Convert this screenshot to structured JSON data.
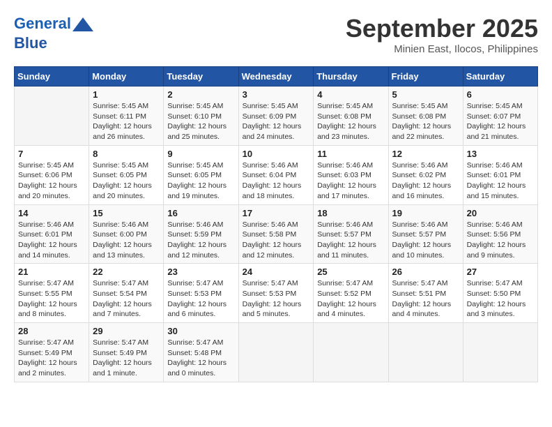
{
  "header": {
    "logo_line1": "General",
    "logo_line2": "Blue",
    "month": "September 2025",
    "location": "Minien East, Ilocos, Philippines"
  },
  "days_of_week": [
    "Sunday",
    "Monday",
    "Tuesday",
    "Wednesday",
    "Thursday",
    "Friday",
    "Saturday"
  ],
  "weeks": [
    [
      {
        "day": "",
        "content": ""
      },
      {
        "day": "1",
        "content": "Sunrise: 5:45 AM\nSunset: 6:11 PM\nDaylight: 12 hours\nand 26 minutes."
      },
      {
        "day": "2",
        "content": "Sunrise: 5:45 AM\nSunset: 6:10 PM\nDaylight: 12 hours\nand 25 minutes."
      },
      {
        "day": "3",
        "content": "Sunrise: 5:45 AM\nSunset: 6:09 PM\nDaylight: 12 hours\nand 24 minutes."
      },
      {
        "day": "4",
        "content": "Sunrise: 5:45 AM\nSunset: 6:08 PM\nDaylight: 12 hours\nand 23 minutes."
      },
      {
        "day": "5",
        "content": "Sunrise: 5:45 AM\nSunset: 6:08 PM\nDaylight: 12 hours\nand 22 minutes."
      },
      {
        "day": "6",
        "content": "Sunrise: 5:45 AM\nSunset: 6:07 PM\nDaylight: 12 hours\nand 21 minutes."
      }
    ],
    [
      {
        "day": "7",
        "content": "Sunrise: 5:45 AM\nSunset: 6:06 PM\nDaylight: 12 hours\nand 20 minutes."
      },
      {
        "day": "8",
        "content": "Sunrise: 5:45 AM\nSunset: 6:05 PM\nDaylight: 12 hours\nand 20 minutes."
      },
      {
        "day": "9",
        "content": "Sunrise: 5:45 AM\nSunset: 6:05 PM\nDaylight: 12 hours\nand 19 minutes."
      },
      {
        "day": "10",
        "content": "Sunrise: 5:46 AM\nSunset: 6:04 PM\nDaylight: 12 hours\nand 18 minutes."
      },
      {
        "day": "11",
        "content": "Sunrise: 5:46 AM\nSunset: 6:03 PM\nDaylight: 12 hours\nand 17 minutes."
      },
      {
        "day": "12",
        "content": "Sunrise: 5:46 AM\nSunset: 6:02 PM\nDaylight: 12 hours\nand 16 minutes."
      },
      {
        "day": "13",
        "content": "Sunrise: 5:46 AM\nSunset: 6:01 PM\nDaylight: 12 hours\nand 15 minutes."
      }
    ],
    [
      {
        "day": "14",
        "content": "Sunrise: 5:46 AM\nSunset: 6:01 PM\nDaylight: 12 hours\nand 14 minutes."
      },
      {
        "day": "15",
        "content": "Sunrise: 5:46 AM\nSunset: 6:00 PM\nDaylight: 12 hours\nand 13 minutes."
      },
      {
        "day": "16",
        "content": "Sunrise: 5:46 AM\nSunset: 5:59 PM\nDaylight: 12 hours\nand 12 minutes."
      },
      {
        "day": "17",
        "content": "Sunrise: 5:46 AM\nSunset: 5:58 PM\nDaylight: 12 hours\nand 12 minutes."
      },
      {
        "day": "18",
        "content": "Sunrise: 5:46 AM\nSunset: 5:57 PM\nDaylight: 12 hours\nand 11 minutes."
      },
      {
        "day": "19",
        "content": "Sunrise: 5:46 AM\nSunset: 5:57 PM\nDaylight: 12 hours\nand 10 minutes."
      },
      {
        "day": "20",
        "content": "Sunrise: 5:46 AM\nSunset: 5:56 PM\nDaylight: 12 hours\nand 9 minutes."
      }
    ],
    [
      {
        "day": "21",
        "content": "Sunrise: 5:47 AM\nSunset: 5:55 PM\nDaylight: 12 hours\nand 8 minutes."
      },
      {
        "day": "22",
        "content": "Sunrise: 5:47 AM\nSunset: 5:54 PM\nDaylight: 12 hours\nand 7 minutes."
      },
      {
        "day": "23",
        "content": "Sunrise: 5:47 AM\nSunset: 5:53 PM\nDaylight: 12 hours\nand 6 minutes."
      },
      {
        "day": "24",
        "content": "Sunrise: 5:47 AM\nSunset: 5:53 PM\nDaylight: 12 hours\nand 5 minutes."
      },
      {
        "day": "25",
        "content": "Sunrise: 5:47 AM\nSunset: 5:52 PM\nDaylight: 12 hours\nand 4 minutes."
      },
      {
        "day": "26",
        "content": "Sunrise: 5:47 AM\nSunset: 5:51 PM\nDaylight: 12 hours\nand 4 minutes."
      },
      {
        "day": "27",
        "content": "Sunrise: 5:47 AM\nSunset: 5:50 PM\nDaylight: 12 hours\nand 3 minutes."
      }
    ],
    [
      {
        "day": "28",
        "content": "Sunrise: 5:47 AM\nSunset: 5:49 PM\nDaylight: 12 hours\nand 2 minutes."
      },
      {
        "day": "29",
        "content": "Sunrise: 5:47 AM\nSunset: 5:49 PM\nDaylight: 12 hours\nand 1 minute."
      },
      {
        "day": "30",
        "content": "Sunrise: 5:47 AM\nSunset: 5:48 PM\nDaylight: 12 hours\nand 0 minutes."
      },
      {
        "day": "",
        "content": ""
      },
      {
        "day": "",
        "content": ""
      },
      {
        "day": "",
        "content": ""
      },
      {
        "day": "",
        "content": ""
      }
    ]
  ]
}
